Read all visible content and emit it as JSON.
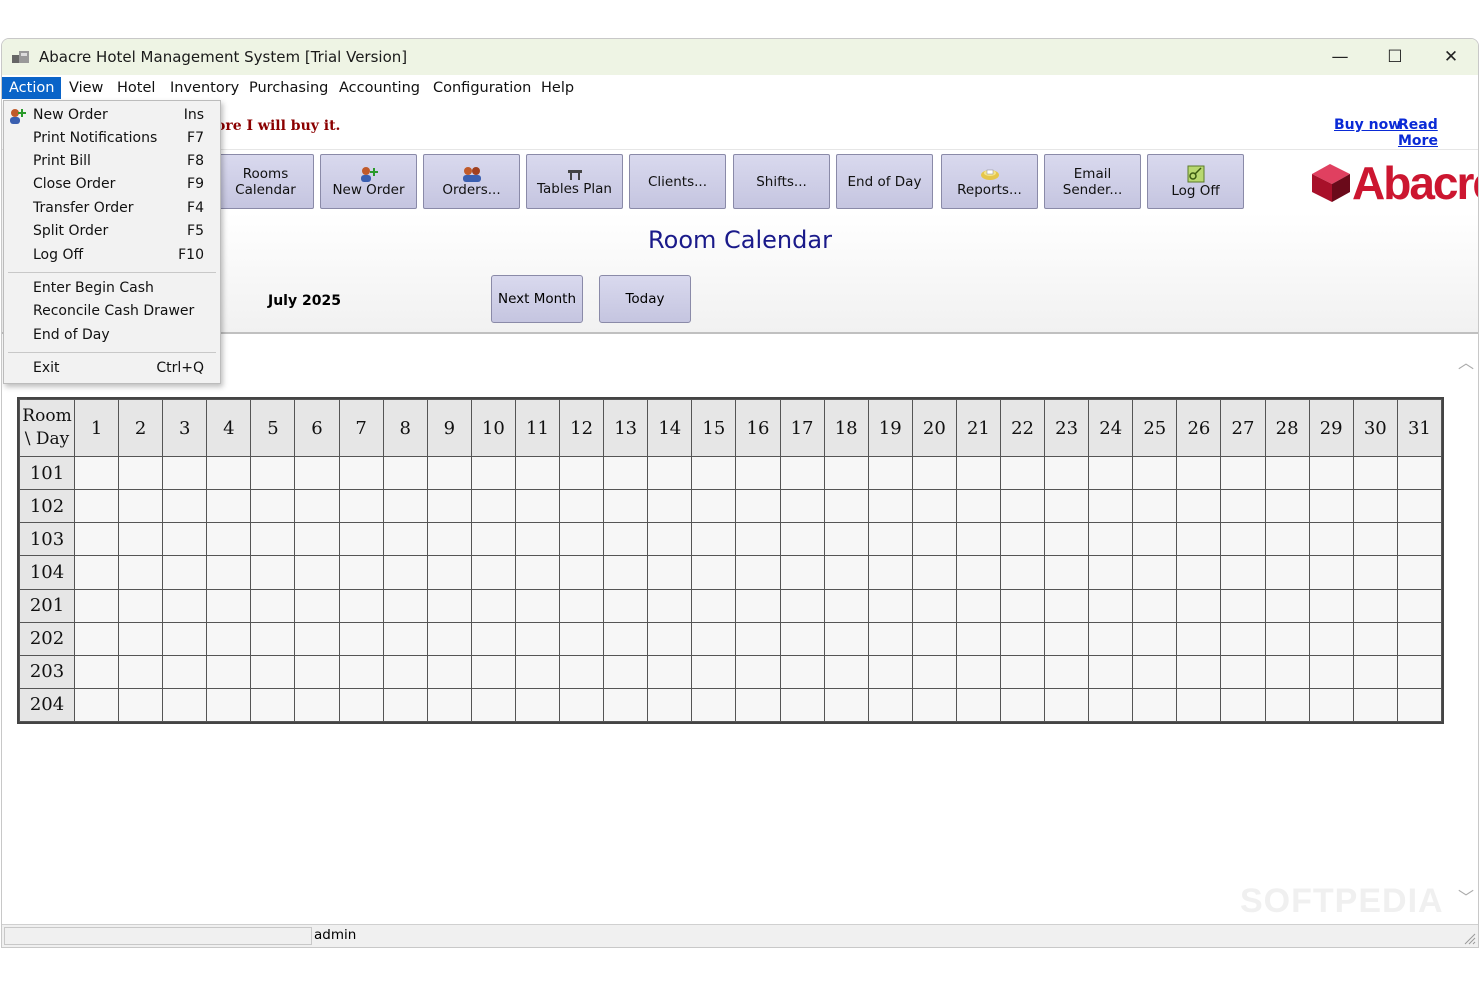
{
  "window": {
    "title": "Abacre Hotel Management System [Trial Version]",
    "controls": {
      "minimize": "—",
      "maximize": "☐",
      "close": "✕"
    }
  },
  "menubar": [
    "Action",
    "View",
    "Hotel",
    "Inventory",
    "Purchasing",
    "Accounting",
    "Configuration",
    "Help"
  ],
  "trial": {
    "message": "ore I will buy it.",
    "buy_now": "Buy now",
    "read_more": "Read More"
  },
  "toolbar": [
    {
      "line1": "Rooms",
      "line2": "Calendar",
      "icon": ""
    },
    {
      "line1": "New Order",
      "line2": "",
      "icon": "new-order-icon"
    },
    {
      "line1": "Orders...",
      "line2": "",
      "icon": "orders-icon"
    },
    {
      "line1": "Tables Plan",
      "line2": "",
      "icon": "tables-icon"
    },
    {
      "line1": "Clients...",
      "line2": "",
      "icon": ""
    },
    {
      "line1": "Shifts...",
      "line2": "",
      "icon": ""
    },
    {
      "line1": "End of Day",
      "line2": "",
      "icon": ""
    },
    {
      "line1": "Reports...",
      "line2": "",
      "icon": "reports-icon"
    },
    {
      "line1": "Email",
      "line2": "Sender...",
      "icon": ""
    },
    {
      "line1": "Log Off",
      "line2": "",
      "icon": "key-icon"
    }
  ],
  "logo": {
    "text": "Abacre",
    "color": "#cc1630"
  },
  "calendar": {
    "title": "Room Calendar",
    "month": "July 2025",
    "next_month": "Next Month",
    "today": "Today",
    "corner_line1": "Room",
    "corner_line2": "\\ Day",
    "days": [
      "1",
      "2",
      "3",
      "4",
      "5",
      "6",
      "7",
      "8",
      "9",
      "10",
      "11",
      "12",
      "13",
      "14",
      "15",
      "16",
      "17",
      "18",
      "19",
      "20",
      "21",
      "22",
      "23",
      "24",
      "25",
      "26",
      "27",
      "28",
      "29",
      "30",
      "31"
    ],
    "rooms": [
      "101",
      "102",
      "103",
      "104",
      "201",
      "202",
      "203",
      "204"
    ]
  },
  "status": {
    "user": "admin"
  },
  "watermark": "SOFTPEDIA",
  "action_menu": {
    "group1": [
      {
        "label": "New Order",
        "key": "Ins"
      },
      {
        "label": "Print Notifications",
        "key": "F7"
      },
      {
        "label": "Print Bill",
        "key": "F8"
      },
      {
        "label": "Close Order",
        "key": "F9"
      },
      {
        "label": "Transfer Order",
        "key": "F4"
      },
      {
        "label": "Split Order",
        "key": "F5"
      },
      {
        "label": "Log Off",
        "key": "F10"
      }
    ],
    "group2": [
      {
        "label": "Enter Begin Cash",
        "key": ""
      },
      {
        "label": "Reconcile Cash Drawer",
        "key": ""
      },
      {
        "label": "End of Day",
        "key": ""
      }
    ],
    "group3": [
      {
        "label": "Exit",
        "key": "Ctrl+Q"
      }
    ]
  },
  "colors": {
    "accent": "#0a64c8",
    "button": "#c9c9e2",
    "title_text": "#1a1a8a",
    "trial_text": "#8b0000",
    "link": "#0a2ad6"
  }
}
